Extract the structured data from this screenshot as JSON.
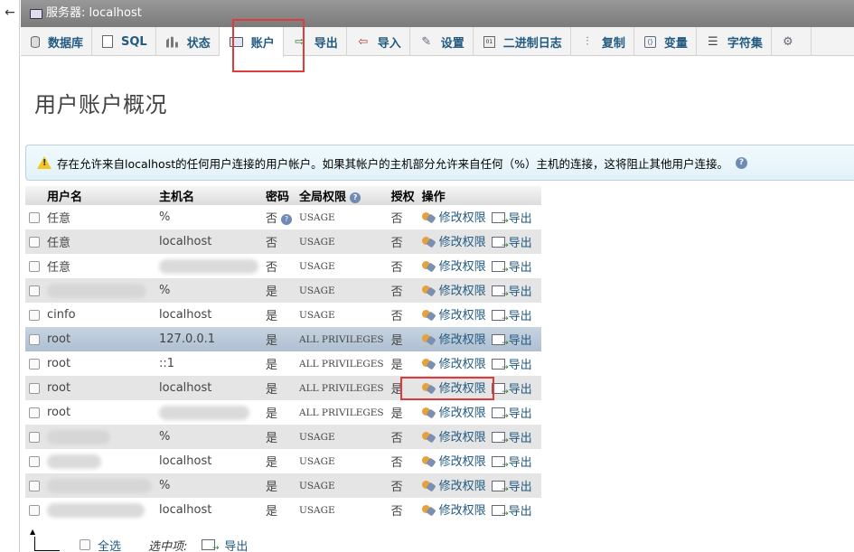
{
  "titlebar": {
    "back": "←",
    "server_title": "服务器: localhost"
  },
  "tabs": [
    {
      "label": "数据库",
      "icon": "database-icon"
    },
    {
      "label": "SQL",
      "icon": "sql-icon"
    },
    {
      "label": "状态",
      "icon": "status-icon"
    },
    {
      "label": "账户",
      "icon": "accounts-icon",
      "active": true
    },
    {
      "label": "导出",
      "icon": "export-icon"
    },
    {
      "label": "导入",
      "icon": "import-icon"
    },
    {
      "label": "设置",
      "icon": "settings-icon"
    },
    {
      "label": "二进制日志",
      "icon": "binlog-icon"
    },
    {
      "label": "复制",
      "icon": "replication-icon"
    },
    {
      "label": "变量",
      "icon": "variables-icon"
    },
    {
      "label": "字符集",
      "icon": "charset-icon"
    }
  ],
  "page": {
    "title": "用户账户概况"
  },
  "notice": {
    "text": "存在允许来自localhost的任何用户连接的用户帐户。如果其帐户的主机部分允许来自任何（%）主机的连接，这将阻止其他用户连接。"
  },
  "table": {
    "headers": {
      "user": "用户名",
      "host": "主机名",
      "password": "密码",
      "global_priv": "全局权限",
      "grant": "授权",
      "action": "操作"
    },
    "edit_label": "修改权限",
    "export_label": "导出",
    "rows": [
      {
        "user": "任意",
        "user_red": true,
        "host": "%",
        "password": "否",
        "password_red": true,
        "priv": "USAGE",
        "grant": "否"
      },
      {
        "user": "任意",
        "user_red": true,
        "host": "localhost",
        "password": "否",
        "password_red": true,
        "priv": "USAGE",
        "grant": "否"
      },
      {
        "user": "任意",
        "user_red": true,
        "host": "",
        "password": "否",
        "password_red": true,
        "priv": "USAGE",
        "grant": "否"
      },
      {
        "user": "",
        "host": "%",
        "password": "是",
        "priv": "USAGE",
        "grant": "否"
      },
      {
        "user": "c",
        "user_tail": "info",
        "host": "localhost",
        "password": "是",
        "priv": "USAGE",
        "grant": "否"
      },
      {
        "user": "root",
        "host": "127.0.0.1",
        "password": "是",
        "priv": "ALL PRIVILEGES",
        "grant": "是"
      },
      {
        "user": "root",
        "host": "::1",
        "password": "是",
        "priv": "ALL PRIVILEGES",
        "grant": "是"
      },
      {
        "user": "root",
        "host": "localhost",
        "password": "是",
        "priv": "ALL PRIVILEGES",
        "grant": "是"
      },
      {
        "user": "root",
        "host": "",
        "password": "是",
        "priv": "ALL PRIVILEGES",
        "grant": "是"
      },
      {
        "user": "",
        "host": "%",
        "password": "是",
        "priv": "USAGE",
        "grant": "否"
      },
      {
        "user": "",
        "host": "localhost",
        "password": "是",
        "priv": "USAGE",
        "grant": "否"
      },
      {
        "user": "",
        "host": "%",
        "password": "是",
        "priv": "USAGE",
        "grant": "否"
      },
      {
        "user": "",
        "host": "localhost",
        "password": "是",
        "priv": "USAGE",
        "grant": "否"
      }
    ]
  },
  "footer": {
    "select_all": "全选",
    "with_selected": "选中项:",
    "export": "导出"
  }
}
